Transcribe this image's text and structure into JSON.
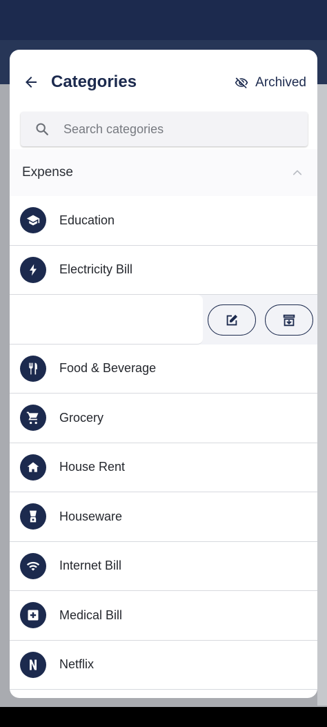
{
  "header": {
    "title": "Categories",
    "archived_label": "Archived"
  },
  "search": {
    "placeholder": "Search categories",
    "value": ""
  },
  "section": {
    "label": "Expense"
  },
  "categories": [
    {
      "label": "Education",
      "icon": "graduation-cap-icon"
    },
    {
      "label": "Electricity Bill",
      "icon": "lightning-icon"
    },
    {
      "label": "Food & Beverage",
      "icon": "fork-knife-icon"
    },
    {
      "label": "Grocery",
      "icon": "shopping-cart-icon"
    },
    {
      "label": "House Rent",
      "icon": "house-icon"
    },
    {
      "label": "Houseware",
      "icon": "blender-icon"
    },
    {
      "label": "Internet Bill",
      "icon": "wifi-icon"
    },
    {
      "label": "Medical Bill",
      "icon": "medical-cross-icon"
    },
    {
      "label": "Netflix",
      "icon": "netflix-icon"
    }
  ],
  "swipe_actions": {
    "edit_icon": "edit-icon",
    "archive_icon": "archive-icon"
  },
  "colors": {
    "primary": "#1c2a4e",
    "divider": "#d7d9de",
    "search_bg": "#f3f3f6"
  }
}
